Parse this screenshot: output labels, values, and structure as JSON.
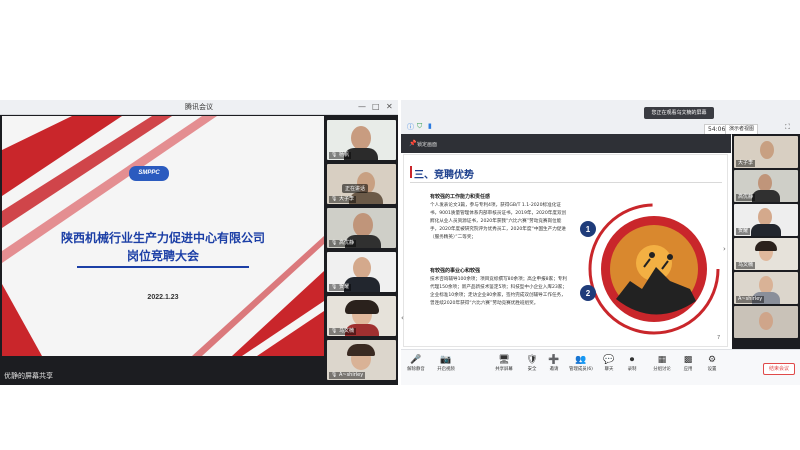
{
  "left_window": {
    "title": "腾讯会议",
    "controls": [
      "—",
      "□",
      "✕"
    ],
    "slide": {
      "logo": "SMPPC",
      "title_line1": "陕西机械行业生产力促进中心有限公司",
      "title_line2": "岗位竞聘大会",
      "date": "2022.1.23"
    },
    "share_label": "优静的屏幕共享",
    "talking": "正在讲话",
    "participants": [
      "杨帆",
      "大子李",
      "高优静",
      "贺耀",
      "乌文楠",
      "A~shirley"
    ]
  },
  "right_window": {
    "sharing_pill": "您正在观看乌文楠的屏幕",
    "time": "54:06",
    "view_button": "演示者视图",
    "locked_label": "锁定画面",
    "slide": {
      "heading": "三、竞聘优势",
      "section1_title": "有较强的工作能力和责任感",
      "section1_body": "个人发表论文3篇，参与专利4项，获得GB/T 1.1-2020标准化证书，9001质量管理体系内部审核员证书，2019年，2020年度双创孵化从业人员资源证书，2020年获我“六比六赛”劳动竞赛岗位能手，2020年度被研究院评为优秀员工，2020年度“中国生产力促进（服务精英）”二等奖；",
      "section2_title": "有较强的事业心和较强",
      "section2_body": "技术咨询辅导100余项；项目竞标撰写80余项；高企申报8家；专利代理150余项；新产品新技术鉴定5项；科技型中小企业入库23家；企业标准10余项；走访企业80余家，签约完成双创辅导工作任务，曾连续2020年获得“六比六赛”劳动竞赛优胜班组奖。",
      "badge1": "1",
      "badge2": "2",
      "page_number": "7"
    },
    "participants": [
      "大子李",
      "高优静",
      "贺耀",
      "乌文楠",
      "A~shirley",
      ""
    ],
    "toolbar": [
      {
        "icon": "🎤",
        "label": "解除静音"
      },
      {
        "icon": "📷",
        "label": "开启视频"
      },
      {
        "icon": "🖥",
        "label": "共享屏幕"
      },
      {
        "icon": "🛡",
        "label": "安全"
      },
      {
        "icon": "➕",
        "label": "邀请"
      },
      {
        "icon": "👥",
        "label": "管理成员(6)"
      },
      {
        "icon": "💬",
        "label": "聊天"
      },
      {
        "icon": "⏺",
        "label": "录制"
      },
      {
        "icon": "▦",
        "label": "分组讨论"
      },
      {
        "icon": "▩",
        "label": "应用"
      },
      {
        "icon": "⚙",
        "label": "设置"
      }
    ],
    "end_button": "结束会议"
  }
}
